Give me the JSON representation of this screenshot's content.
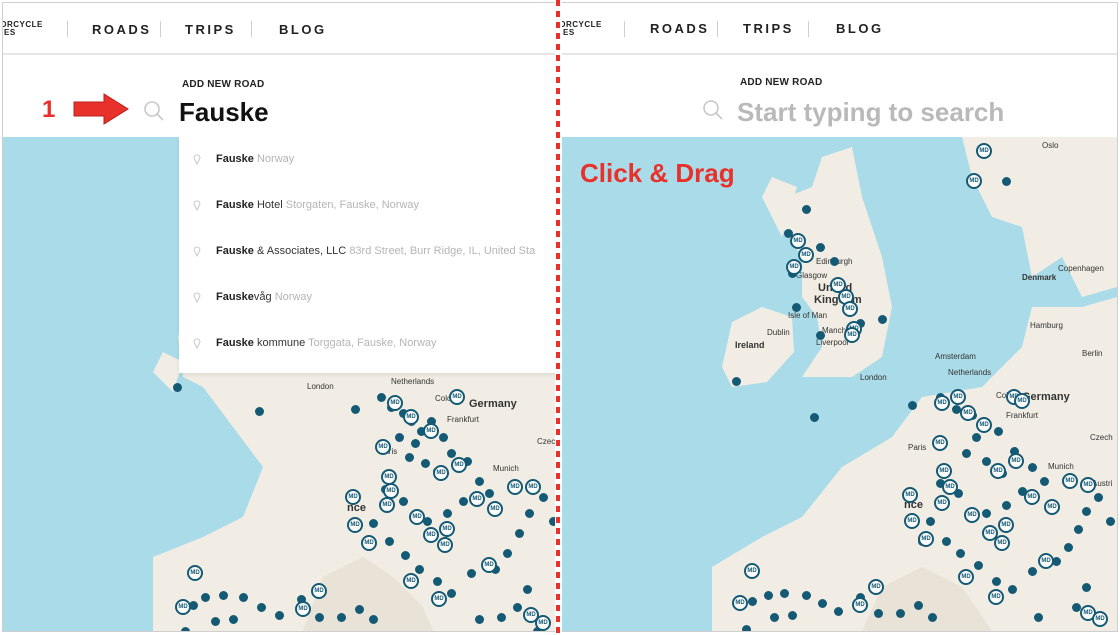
{
  "nav": {
    "brand_lines": [
      "TORCYCLE",
      "RIES"
    ],
    "links": [
      "ROADS",
      "TRIPS",
      "BLOG"
    ]
  },
  "left_panel": {
    "kicker": "ADD NEW ROAD",
    "search_value": "Fauske",
    "suggestions": [
      {
        "match": "Fauske",
        "rest": "",
        "detail": "Norway"
      },
      {
        "match": "Fauske",
        "rest": " Hotel",
        "detail": "Storgaten, Fauske, Norway"
      },
      {
        "match": "Fauske",
        "rest": " & Associates, LLC",
        "detail": "83rd Street, Burr Ridge, IL, United Sta"
      },
      {
        "match": "Fauske",
        "rest": "våg",
        "detail": "Norway"
      },
      {
        "match": "Fauske",
        "rest": " kommune",
        "detail": "Torggata, Fauske, Norway"
      }
    ]
  },
  "right_panel": {
    "kicker": "ADD NEW ROAD",
    "search_placeholder": "Start typing to search"
  },
  "annotations": {
    "step_number": "1",
    "click_drag": "Click & Drag"
  },
  "map": {
    "marker_label": "MD",
    "labels_left": {
      "netherlands": "Netherlands",
      "germany": "Germany",
      "london": "London",
      "cologne": "Cologn",
      "frankfurt": "Frankfurt",
      "paris": "Paris",
      "munich": "Munich",
      "czech": "Czec",
      "france": "nce"
    },
    "labels_right": {
      "oslo": "Oslo",
      "denmark": "Denmark",
      "copenhagen": "Copenhagen",
      "glasgow": "Glasgow",
      "edinburgh": "Edinburgh",
      "united": "United",
      "kingdom": "Kingdom",
      "isle_of_man": "Isle of Man",
      "dublin": "Dublin",
      "ireland": "Ireland",
      "manchester": "Manche",
      "liverpool": "Liverpool",
      "london": "London",
      "hamburg": "Hamburg",
      "amsterdam": "Amsterdam",
      "netherlands": "Netherlands",
      "berlin": "Berlin",
      "cologne": "Cologne",
      "germany": "Germany",
      "frankfurt": "Frankfurt",
      "paris": "Paris",
      "munich": "Munich",
      "czech": "Czech",
      "austria": "Austri",
      "france": "nce"
    }
  },
  "colors": {
    "water": "#aadbe8",
    "land": "#f1ede4",
    "marker": "#155a74",
    "annotation_red": "#e8312b"
  }
}
